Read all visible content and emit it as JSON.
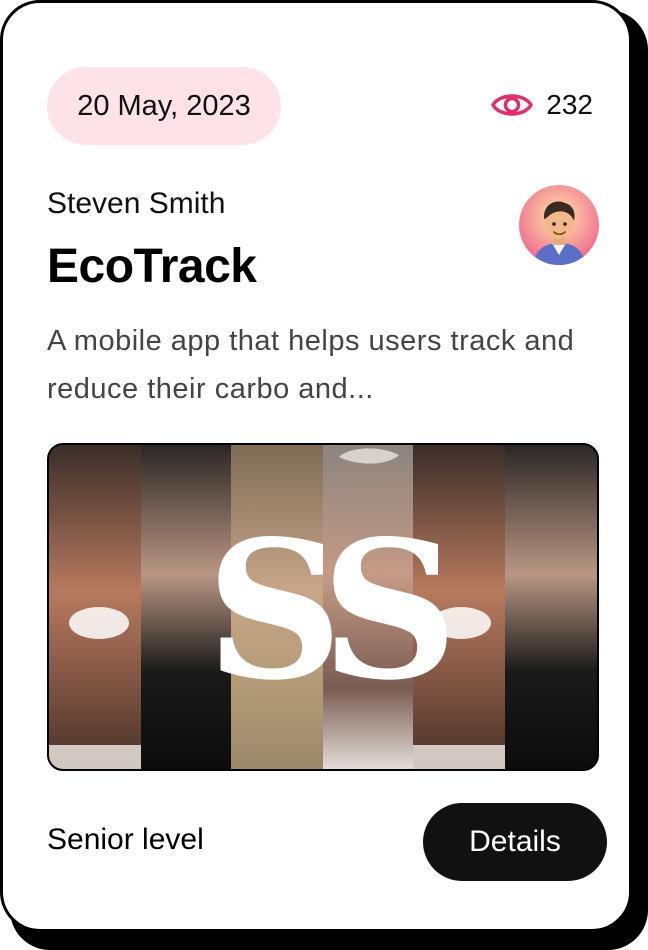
{
  "card": {
    "date": "20 May, 2023",
    "views": "232",
    "author": "Steven Smith",
    "title": "EcoTrack",
    "description": "A mobile app that helps users track and reduce their carbo and...",
    "level": "Senior level",
    "details_label": "Details",
    "cover_logo_text": "SS"
  },
  "icons": {
    "views": "eye-icon"
  },
  "colors": {
    "date_pill_bg": "#fde2e8",
    "eye_icon": "#e0306a",
    "button_bg": "#111111",
    "button_text": "#ffffff"
  }
}
